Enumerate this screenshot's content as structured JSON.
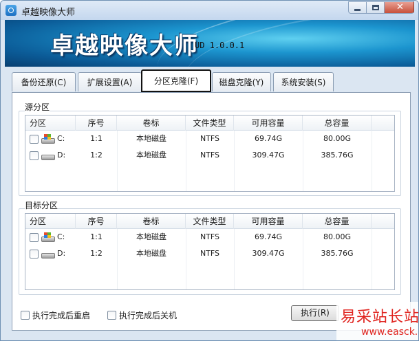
{
  "window": {
    "title": "卓越映像大师"
  },
  "banner": {
    "title": "卓越映像大师",
    "version": "UD 1.0.0.1"
  },
  "tabs": [
    {
      "label": "备份还原(C)"
    },
    {
      "label": "扩展设置(A)"
    },
    {
      "label": "分区克隆(F)",
      "active": true
    },
    {
      "label": "磁盘克隆(Y)"
    },
    {
      "label": "系统安装(S)"
    }
  ],
  "columns": [
    "分区",
    "序号",
    "卷标",
    "文件类型",
    "可用容量",
    "总容量"
  ],
  "source": {
    "label": "源分区",
    "rows": [
      {
        "drive": "C:",
        "index": "1:1",
        "volume": "本地磁盘",
        "fs": "NTFS",
        "free": "69.74G",
        "total": "80.00G",
        "icon": "windows-drive-icon"
      },
      {
        "drive": "D:",
        "index": "1:2",
        "volume": "本地磁盘",
        "fs": "NTFS",
        "free": "309.47G",
        "total": "385.76G",
        "icon": "hard-drive-icon"
      }
    ]
  },
  "target": {
    "label": "目标分区",
    "rows": [
      {
        "drive": "C:",
        "index": "1:1",
        "volume": "本地磁盘",
        "fs": "NTFS",
        "free": "69.74G",
        "total": "80.00G",
        "icon": "windows-drive-icon"
      },
      {
        "drive": "D:",
        "index": "1:2",
        "volume": "本地磁盘",
        "fs": "NTFS",
        "free": "309.47G",
        "total": "385.76G",
        "icon": "hard-drive-icon"
      }
    ]
  },
  "options": {
    "restart_label": "执行完成后重启",
    "shutdown_label": "执行完成后关机"
  },
  "execute_label": "执行(R)",
  "watermark": {
    "title": "易采站长站",
    "url": "www.easck.com"
  },
  "colors": {
    "banner": "#1c95cf",
    "tab_highlight": "#111111",
    "watermark": "#e0241f"
  }
}
